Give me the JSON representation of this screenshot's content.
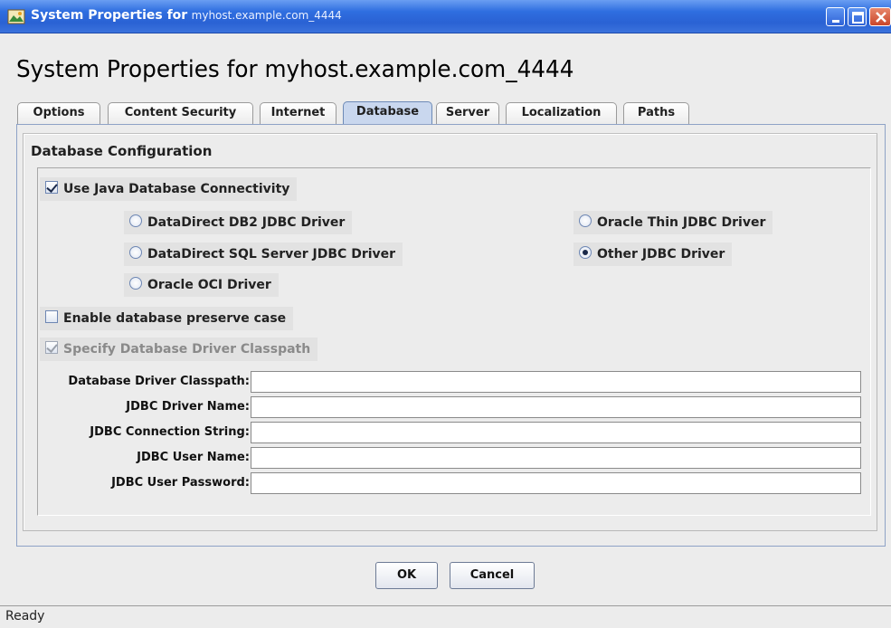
{
  "window": {
    "title_prefix": "System Properties for",
    "title_host": "myhost.example.com_4444"
  },
  "heading": "System Properties for myhost.example.com_4444",
  "tabs": [
    {
      "label": "Options",
      "active": false
    },
    {
      "label": "Content Security",
      "active": false
    },
    {
      "label": "Internet",
      "active": false
    },
    {
      "label": "Database",
      "active": true
    },
    {
      "label": "Server",
      "active": false
    },
    {
      "label": "Localization",
      "active": false
    },
    {
      "label": "Paths",
      "active": false
    }
  ],
  "database": {
    "group_title": "Database Configuration",
    "use_jdbc": {
      "label": "Use Java Database Connectivity",
      "checked": true
    },
    "drivers": [
      {
        "label": "DataDirect DB2 JDBC Driver",
        "selected": false
      },
      {
        "label": "DataDirect SQL Server JDBC Driver",
        "selected": false
      },
      {
        "label": "Oracle OCI Driver",
        "selected": false
      },
      {
        "label": "Oracle Thin JDBC Driver",
        "selected": false
      },
      {
        "label": "Other JDBC Driver",
        "selected": true
      }
    ],
    "preserve_case": {
      "label": "Enable database preserve case",
      "checked": false
    },
    "specify_classpath": {
      "label": "Specify Database Driver Classpath",
      "checked": true,
      "enabled": false
    },
    "fields": [
      {
        "label": "Database Driver Classpath:",
        "value": ""
      },
      {
        "label": "JDBC Driver Name:",
        "value": ""
      },
      {
        "label": "JDBC Connection String:",
        "value": ""
      },
      {
        "label": "JDBC User Name:",
        "value": ""
      },
      {
        "label": "JDBC User Password:",
        "value": ""
      }
    ]
  },
  "buttons": {
    "ok": "OK",
    "cancel": "Cancel"
  },
  "status": "Ready",
  "colors": {
    "titlebar": "#2f6ee0",
    "active_tab": "#c9d7ee",
    "panel_border": "#8ea2c6",
    "background": "#ececec"
  }
}
